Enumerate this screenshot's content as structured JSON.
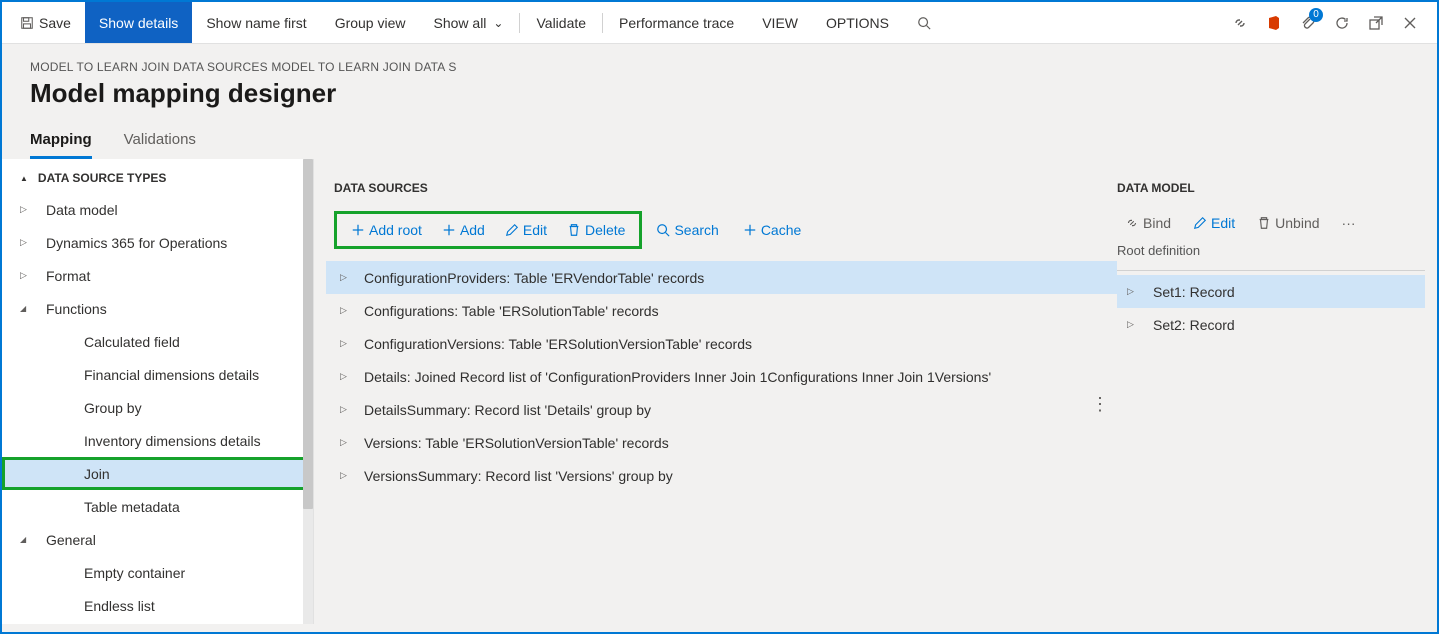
{
  "toolbar": {
    "save": "Save",
    "show_details": "Show details",
    "show_name_first": "Show name first",
    "group_view": "Group view",
    "show_all": "Show all",
    "validate": "Validate",
    "performance_trace": "Performance trace",
    "view": "VIEW",
    "options": "OPTIONS",
    "badge_count": "0"
  },
  "breadcrumb": "MODEL TO LEARN JOIN DATA SOURCES MODEL TO LEARN JOIN DATA S",
  "page_title": "Model mapping designer",
  "tabs": {
    "mapping": "Mapping",
    "validations": "Validations"
  },
  "left_panel": {
    "heading": "DATA SOURCE TYPES",
    "items": [
      {
        "label": "Data model",
        "expandable": true,
        "expanded": false,
        "depth": 0
      },
      {
        "label": "Dynamics 365 for Operations",
        "expandable": true,
        "expanded": false,
        "depth": 0
      },
      {
        "label": "Format",
        "expandable": true,
        "expanded": false,
        "depth": 0
      },
      {
        "label": "Functions",
        "expandable": true,
        "expanded": true,
        "depth": 0
      },
      {
        "label": "Calculated field",
        "expandable": false,
        "depth": 1
      },
      {
        "label": "Financial dimensions details",
        "expandable": false,
        "depth": 1
      },
      {
        "label": "Group by",
        "expandable": false,
        "depth": 1
      },
      {
        "label": "Inventory dimensions details",
        "expandable": false,
        "depth": 1
      },
      {
        "label": "Join",
        "expandable": false,
        "depth": 1,
        "selected": true,
        "highlighted": true
      },
      {
        "label": "Table metadata",
        "expandable": false,
        "depth": 1
      },
      {
        "label": "General",
        "expandable": true,
        "expanded": true,
        "depth": 0
      },
      {
        "label": "Empty container",
        "expandable": false,
        "depth": 1
      },
      {
        "label": "Endless list",
        "expandable": false,
        "depth": 1
      }
    ]
  },
  "middle_panel": {
    "heading": "DATA SOURCES",
    "buttons": {
      "add_root": "Add root",
      "add": "Add",
      "edit": "Edit",
      "delete": "Delete",
      "search": "Search",
      "cache": "Cache"
    },
    "rows": [
      {
        "label": "ConfigurationProviders: Table 'ERVendorTable' records",
        "selected": true
      },
      {
        "label": "Configurations: Table 'ERSolutionTable' records"
      },
      {
        "label": "ConfigurationVersions: Table 'ERSolutionVersionTable' records"
      },
      {
        "label": "Details: Joined Record list of 'ConfigurationProviders Inner Join 1Configurations Inner Join 1Versions'"
      },
      {
        "label": "DetailsSummary: Record list 'Details' group by"
      },
      {
        "label": "Versions: Table 'ERSolutionVersionTable' records"
      },
      {
        "label": "VersionsSummary: Record list 'Versions' group by"
      }
    ]
  },
  "right_panel": {
    "heading": "DATA MODEL",
    "buttons": {
      "bind": "Bind",
      "edit": "Edit",
      "unbind": "Unbind"
    },
    "root_def": "Root definition",
    "rows": [
      {
        "label": "Set1: Record",
        "selected": true
      },
      {
        "label": "Set2: Record"
      }
    ]
  }
}
